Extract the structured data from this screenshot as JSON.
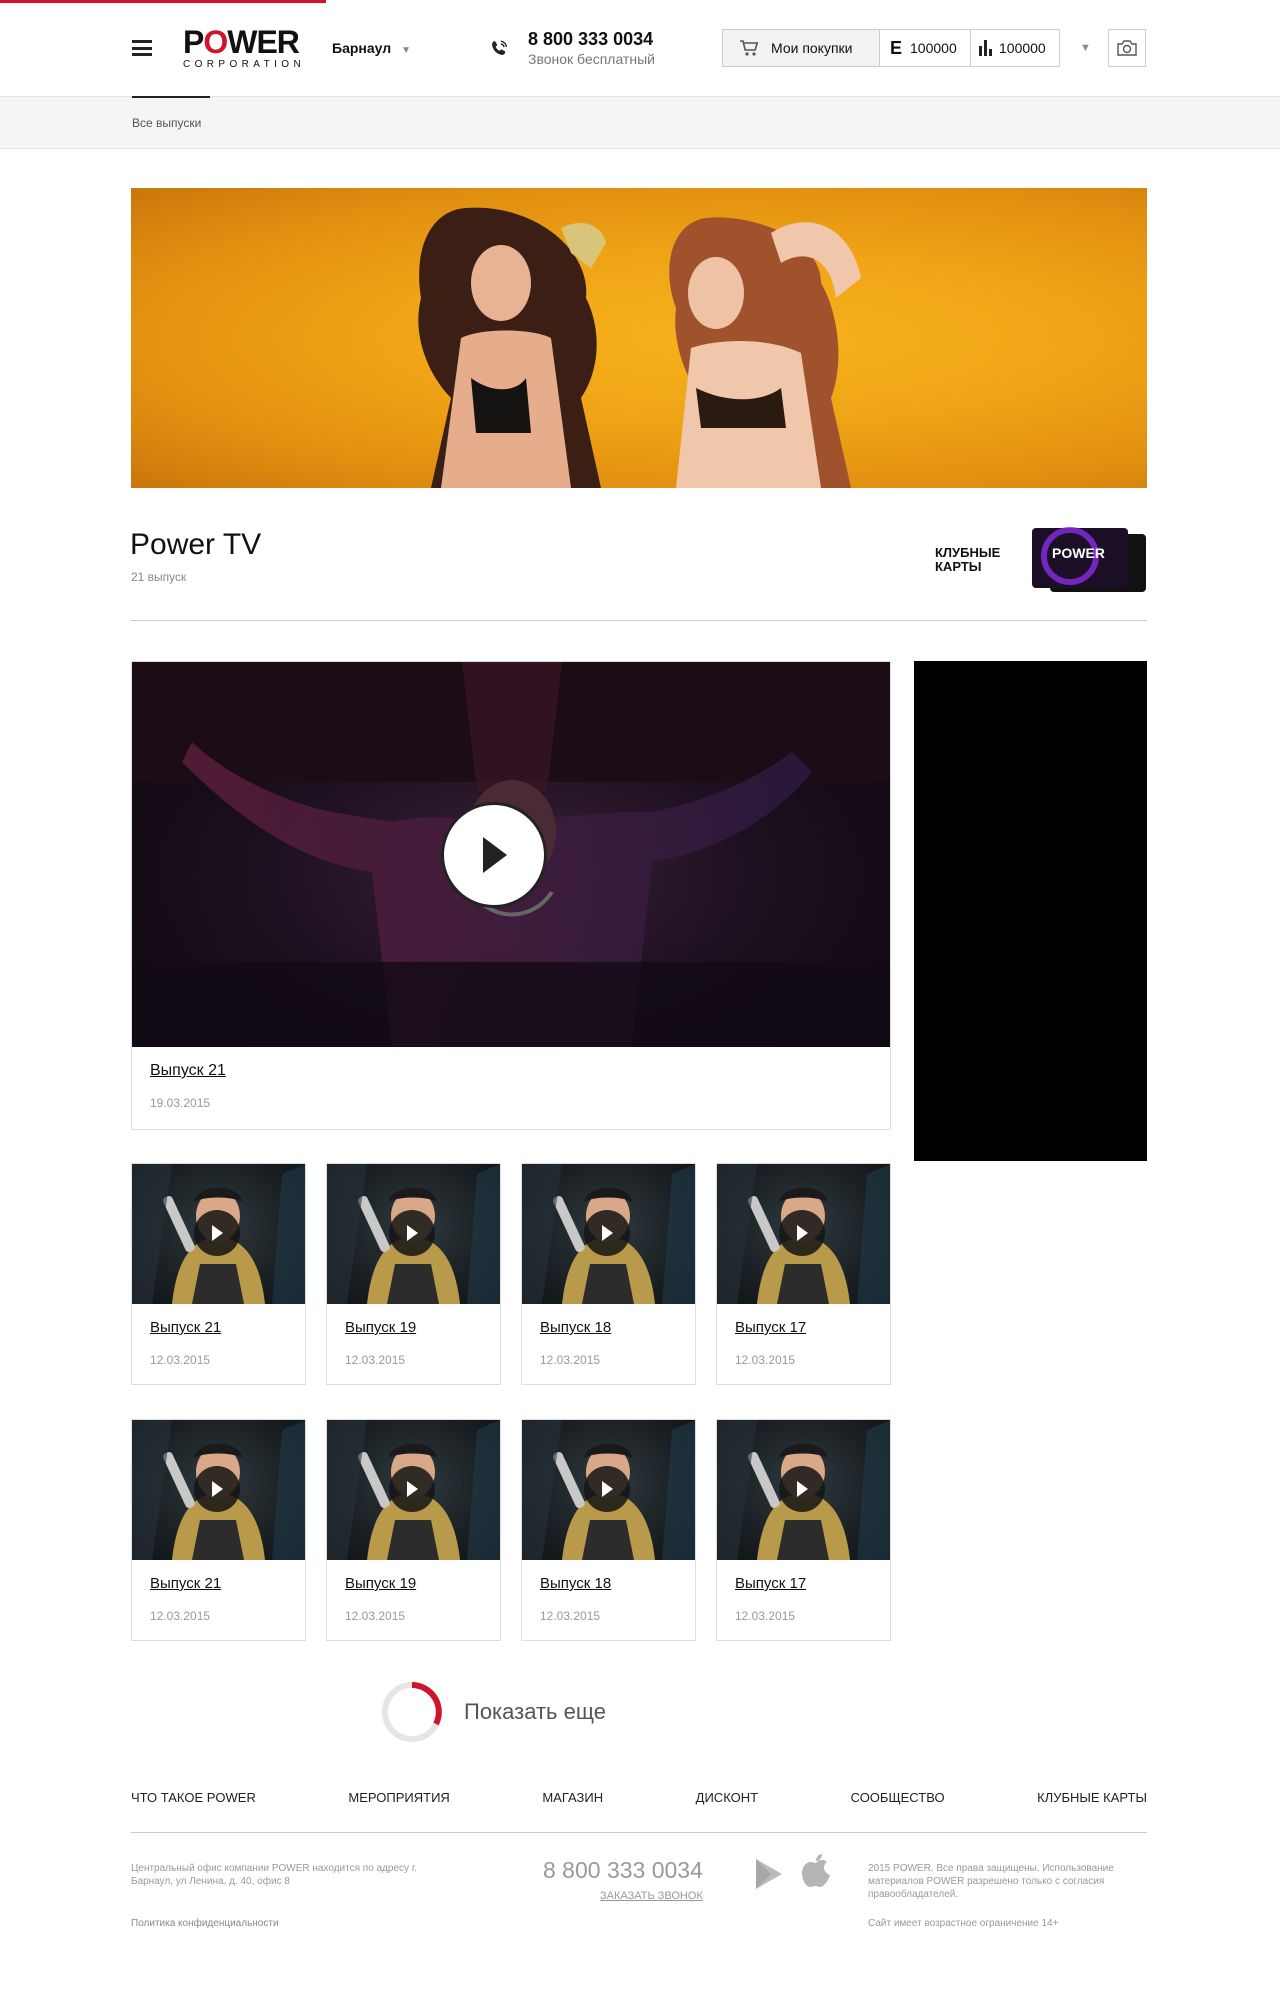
{
  "header": {
    "logo_main_1": "P",
    "logo_main_o": "O",
    "logo_main_2": "WER",
    "logo_sub": "CORPORATION",
    "city": "Барнаул",
    "phone": "8 800 333 0034",
    "phone_note": "Звонок бесплатный",
    "cart_label": "Мои покупки",
    "e_value": "100000",
    "bars_value": "100000"
  },
  "breadcrumb": {
    "label": "Все выпуски"
  },
  "page": {
    "title": "Power TV",
    "count": "21 выпуск",
    "club_label": "Клубные карты"
  },
  "featured": {
    "title": "Выпуск 21",
    "date": "19.03.2015"
  },
  "grid": [
    {
      "title": "Выпуск 21",
      "date": "12.03.2015"
    },
    {
      "title": "Выпуск 19",
      "date": "12.03.2015"
    },
    {
      "title": "Выпуск 18",
      "date": "12.03.2015"
    },
    {
      "title": "Выпуск 17",
      "date": "12.03.2015"
    },
    {
      "title": "Выпуск 21",
      "date": "12.03.2015"
    },
    {
      "title": "Выпуск 19",
      "date": "12.03.2015"
    },
    {
      "title": "Выпуск 18",
      "date": "12.03.2015"
    },
    {
      "title": "Выпуск 17",
      "date": "12.03.2015"
    }
  ],
  "show_more": "Показать еще",
  "footer": {
    "nav": [
      "Что такое POWER",
      "Мероприятия",
      "Магазин",
      "Дисконт",
      "Сообщество",
      "Клубные карты"
    ],
    "address": "Центральный офис компании POWER находится по адресу г. Барнаул, ул Ленина, д. 40, офис 8",
    "privacy": "Политика конфиденциальности",
    "phone": "8 800 333 0034",
    "callback": "ЗАКАЗАТЬ ЗВОНОК",
    "copyright": "2015 POWER. Все права защищены. Использование материалов POWER разрешено только с согласия правообладателей.",
    "age": "Сайт имеет возрастное ограничение 14+"
  },
  "colors": {
    "accent": "#d0142b",
    "hero_bg": "#f0a416",
    "text": "#222222",
    "muted": "#999999"
  },
  "icons": [
    "menu-icon",
    "phone-icon",
    "cart-icon",
    "bars-icon",
    "chevron-down-icon",
    "camera-icon",
    "play-icon",
    "google-play-icon",
    "apple-icon",
    "spinner-icon"
  ]
}
